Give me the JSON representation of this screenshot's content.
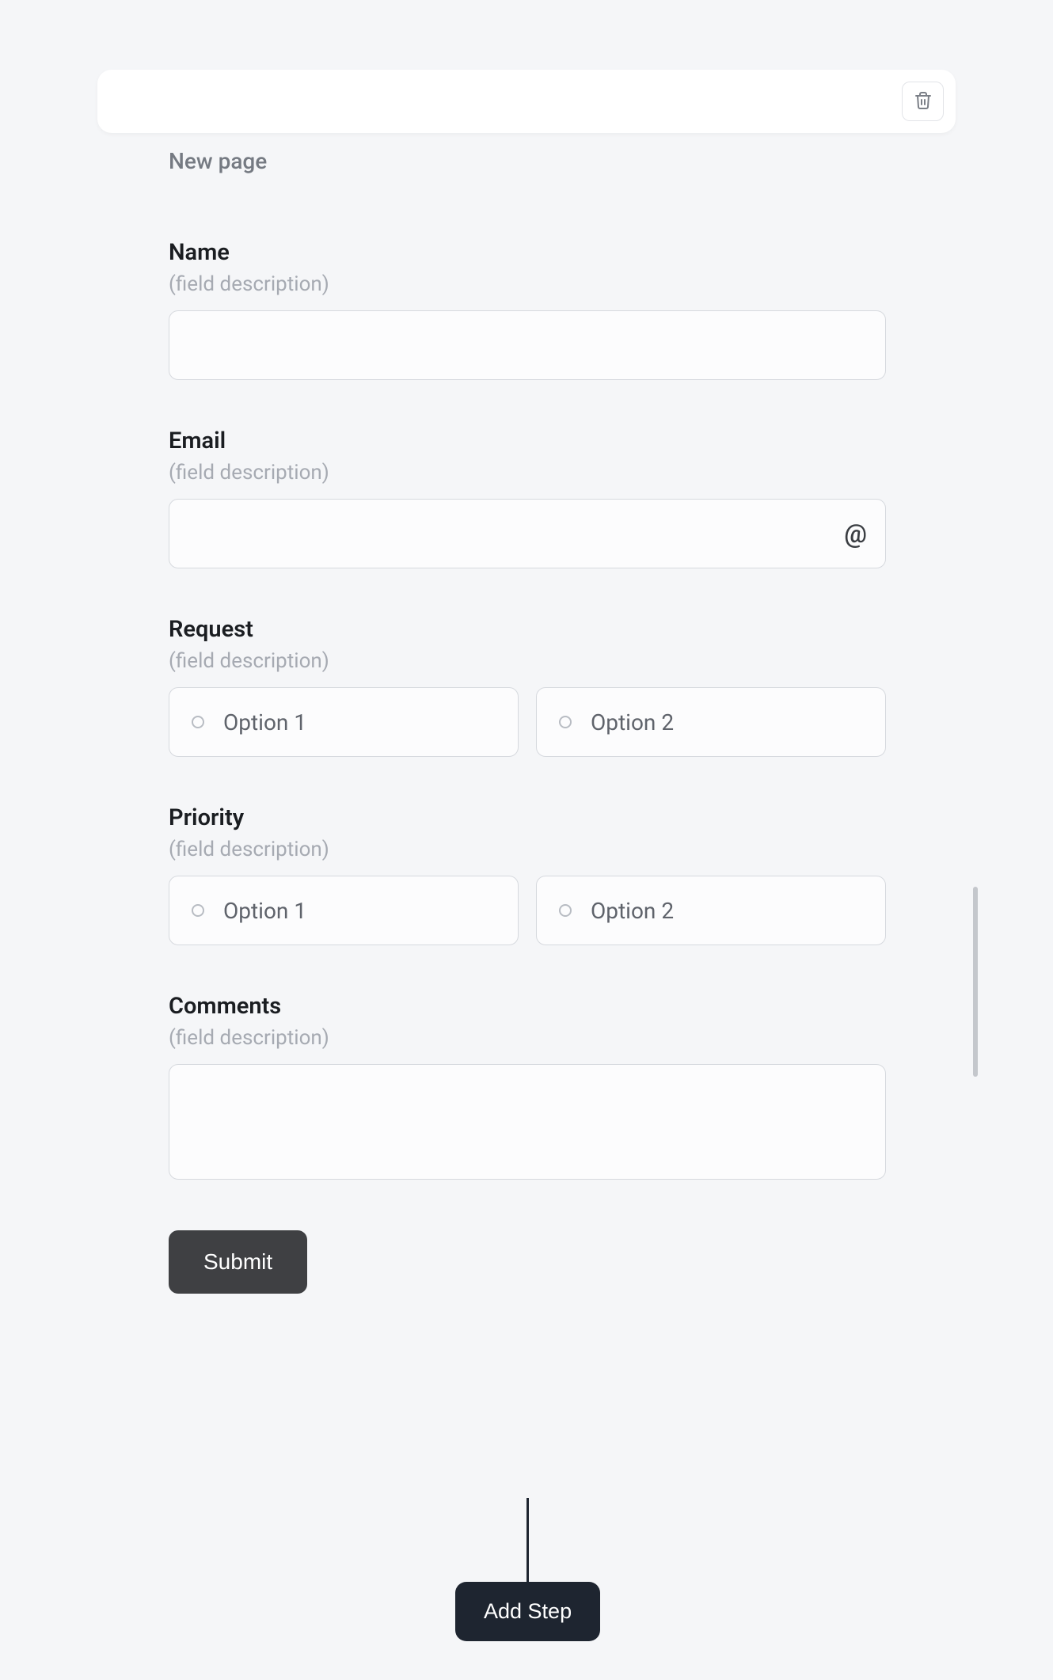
{
  "page": {
    "title": "New page"
  },
  "fields": {
    "name": {
      "label": "Name",
      "desc": "(field description)",
      "value": ""
    },
    "email": {
      "label": "Email",
      "desc": "(field description)",
      "value": "",
      "icon_glyph": "@"
    },
    "request": {
      "label": "Request",
      "desc": "(field description)",
      "options": [
        "Option 1",
        "Option 2"
      ]
    },
    "priority": {
      "label": "Priority",
      "desc": "(field description)",
      "options": [
        "Option 1",
        "Option 2"
      ]
    },
    "comments": {
      "label": "Comments",
      "desc": "(field description)",
      "value": ""
    }
  },
  "buttons": {
    "submit": "Submit",
    "add_step": "Add Step"
  }
}
